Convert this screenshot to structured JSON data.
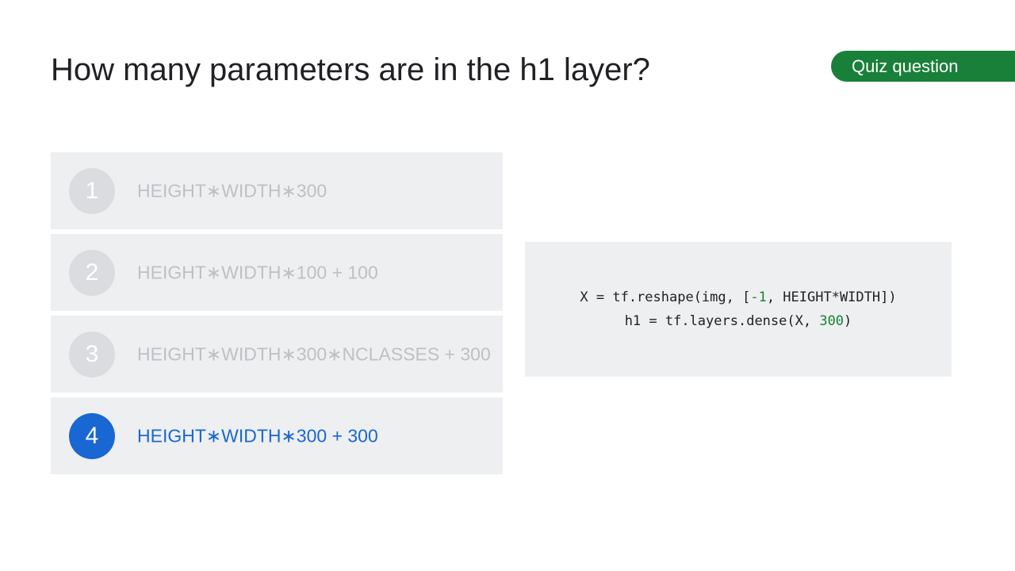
{
  "slide": {
    "title": "How many parameters are in the h1 layer?",
    "badge": "Quiz question"
  },
  "options": [
    {
      "number": "1",
      "text": "HEIGHT∗WIDTH∗300",
      "selected": false
    },
    {
      "number": "2",
      "text": "HEIGHT∗WIDTH∗100 + 100",
      "selected": false
    },
    {
      "number": "3",
      "text": "HEIGHT∗WIDTH∗300∗NCLASSES + 300",
      "selected": false
    },
    {
      "number": "4",
      "text": "HEIGHT∗WIDTH∗300 + 300",
      "selected": true
    }
  ],
  "code": {
    "line1": {
      "pre": "X = tf.reshape(img, [",
      "num": "-1",
      "post": ", HEIGHT*WIDTH])"
    },
    "line2": {
      "pre": "h1 = tf.layers.dense(X, ",
      "num": "300",
      "post": ")"
    }
  },
  "colors": {
    "badge": "#188038",
    "selected": "#1967d2",
    "option_bg": "#eeeff1",
    "code_number": "#188038"
  }
}
